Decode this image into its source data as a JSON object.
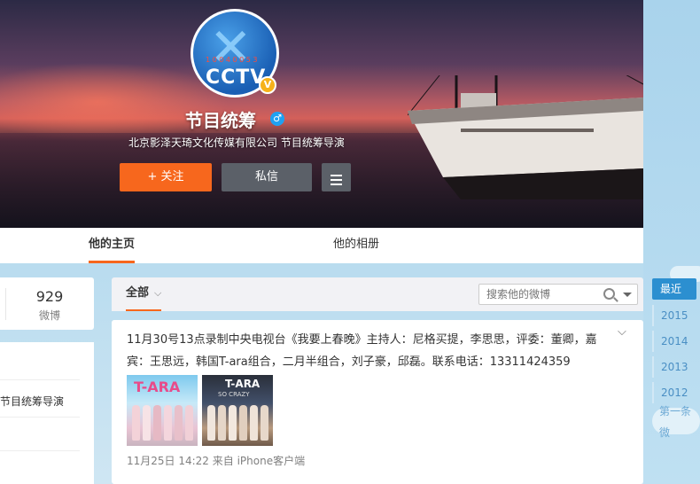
{
  "profile": {
    "name": "节目统筹",
    "intro": "北京影泽天琦文化传媒有限公司 节目统筹导演",
    "avatar_text": "CCTV",
    "avatar_red_text": "1 0 0 4 0 0 5 3",
    "verified_badge": "V",
    "gender_icon": "male-icon",
    "gender_glyph": "♂",
    "follow_label": "+ 关注",
    "message_label": "私信"
  },
  "tabs": [
    {
      "label": "他的主页",
      "active": true
    },
    {
      "label": "他的相册",
      "active": false
    }
  ],
  "stats": {
    "count": "929",
    "label": "微博"
  },
  "left_card": {
    "text": "节目统筹导演"
  },
  "feed": {
    "filter_label": "全部",
    "search_placeholder": "搜索他的微博"
  },
  "post": {
    "text": "11月30号13点录制中央电视台《我要上春晚》主持人：尼格买提，李思思，评委：董卿，嘉宾：王思远，韩国T-ara组合，二月半组合，刘子豪，邱磊。联系电话：13311424359",
    "thumb1_title": "T-ARA",
    "thumb2_title": "T-ARA",
    "thumb2_sub": "SO CRAZY",
    "time": "11月25日 14:22",
    "source": "来自 iPhone客户端"
  },
  "timeline": {
    "items": [
      "最近",
      "2015",
      "2014",
      "2013",
      "2012"
    ],
    "first_label": "第一条微"
  },
  "colors": {
    "accent": "#f7671d",
    "button_dark": "#5b6068",
    "timeline_active": "#2c8fd0",
    "link_blue": "#4a8fc4"
  }
}
